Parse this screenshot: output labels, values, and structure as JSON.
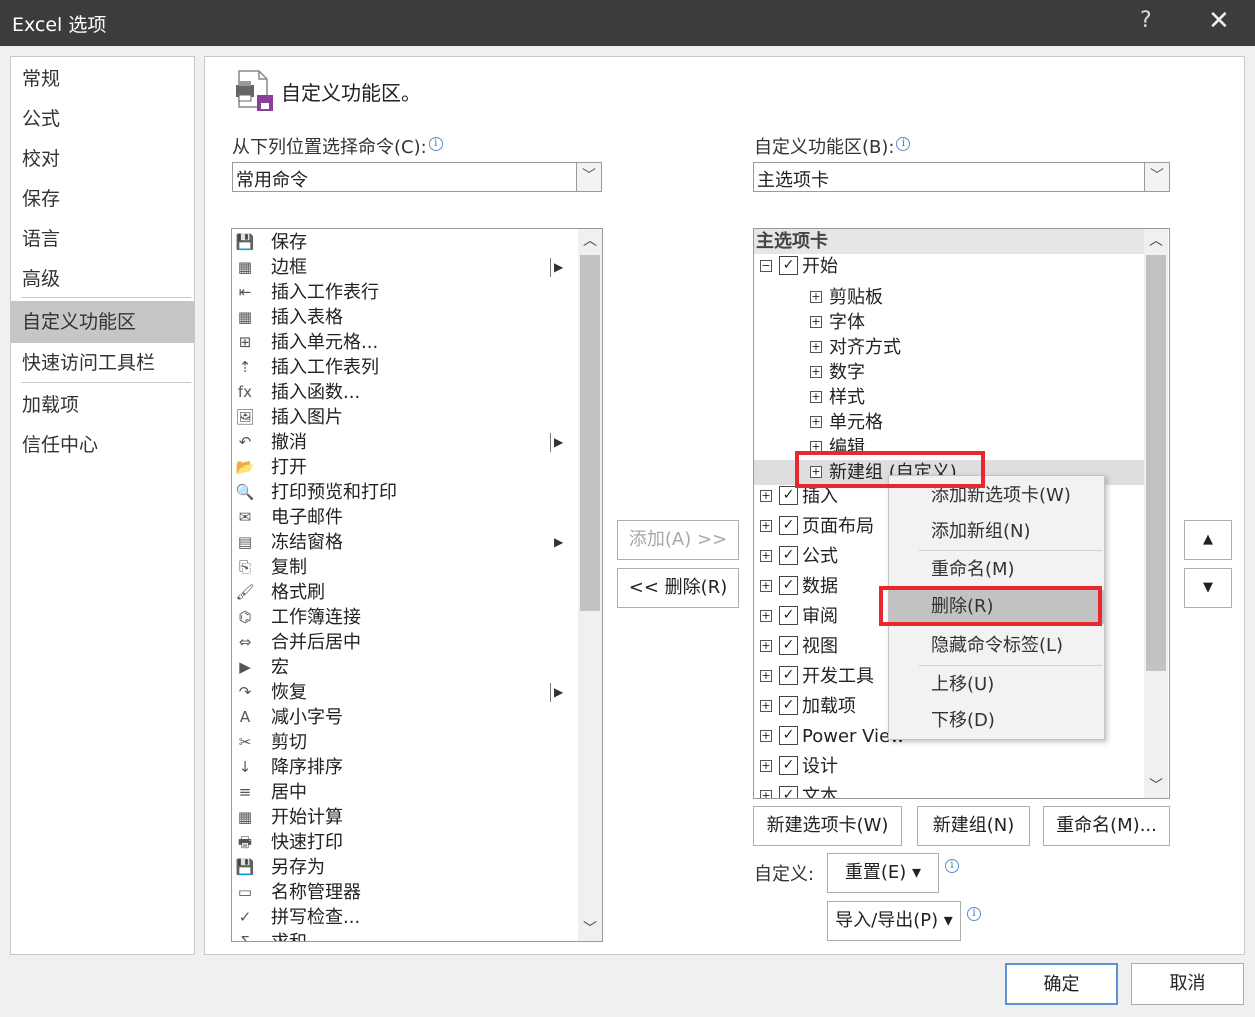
{
  "window": {
    "title": "Excel 选项",
    "help": "?",
    "close": "✕"
  },
  "sidebar": {
    "items": [
      {
        "label": "常规"
      },
      {
        "label": "公式"
      },
      {
        "label": "校对"
      },
      {
        "label": "保存"
      },
      {
        "label": "语言"
      },
      {
        "label": "高级"
      },
      {
        "label": "自定义功能区",
        "selected": true
      },
      {
        "label": "快速访问工具栏"
      },
      {
        "label": "加载项"
      },
      {
        "label": "信任中心"
      }
    ]
  },
  "main": {
    "heading": "自定义功能区。",
    "left_label": "从下列位置选择命令(C):",
    "left_combo": "常用命令",
    "right_label": "自定义功能区(B):",
    "right_combo": "主选项卡",
    "commands": [
      {
        "label": "保存",
        "icon": "save-icon",
        "glyph": "💾"
      },
      {
        "label": "边框",
        "icon": "border-icon",
        "glyph": "▦",
        "submenu": "bar"
      },
      {
        "label": "插入工作表行",
        "icon": "insert-row-icon",
        "glyph": "⇤"
      },
      {
        "label": "插入表格",
        "icon": "table-icon",
        "glyph": "▦"
      },
      {
        "label": "插入单元格...",
        "icon": "insert-cell-icon",
        "glyph": "⊞"
      },
      {
        "label": "插入工作表列",
        "icon": "insert-column-icon",
        "glyph": "⇡"
      },
      {
        "label": "插入函数...",
        "icon": "function-icon",
        "glyph": "fx"
      },
      {
        "label": "插入图片",
        "icon": "picture-icon",
        "glyph": "🖼"
      },
      {
        "label": "撤消",
        "icon": "undo-icon",
        "glyph": "↶",
        "submenu": "bar"
      },
      {
        "label": "打开",
        "icon": "open-folder-icon",
        "glyph": "📂"
      },
      {
        "label": "打印预览和打印",
        "icon": "print-preview-icon",
        "glyph": "🔍"
      },
      {
        "label": "电子邮件",
        "icon": "email-icon",
        "glyph": "✉"
      },
      {
        "label": "冻结窗格",
        "icon": "freeze-panes-icon",
        "glyph": "▤",
        "submenu": "arrow"
      },
      {
        "label": "复制",
        "icon": "copy-icon",
        "glyph": "⎘"
      },
      {
        "label": "格式刷",
        "icon": "format-painter-icon",
        "glyph": "🖌"
      },
      {
        "label": "工作簿连接",
        "icon": "workbook-connection-icon",
        "glyph": "⌬"
      },
      {
        "label": "合并后居中",
        "icon": "merge-center-icon",
        "glyph": "⇔"
      },
      {
        "label": "宏",
        "icon": "macro-icon",
        "glyph": "▶"
      },
      {
        "label": "恢复",
        "icon": "redo-icon",
        "glyph": "↷",
        "submenu": "bar"
      },
      {
        "label": "减小字号",
        "icon": "decrease-font-icon",
        "glyph": "A"
      },
      {
        "label": "剪切",
        "icon": "cut-icon",
        "glyph": "✂"
      },
      {
        "label": "降序排序",
        "icon": "sort-descending-icon",
        "glyph": "↓"
      },
      {
        "label": "居中",
        "icon": "align-center-icon",
        "glyph": "≡"
      },
      {
        "label": "开始计算",
        "icon": "calculator-icon",
        "glyph": "▦"
      },
      {
        "label": "快速打印",
        "icon": "quick-print-icon",
        "glyph": "🖶"
      },
      {
        "label": "另存为",
        "icon": "save-as-icon",
        "glyph": "💾"
      },
      {
        "label": "名称管理器",
        "icon": "name-manager-icon",
        "glyph": "▭"
      },
      {
        "label": "拼写检查...",
        "icon": "spell-check-icon",
        "glyph": "✓"
      },
      {
        "label": "求和",
        "icon": "sum-icon",
        "glyph": "Σ"
      }
    ],
    "add_button": "添加(A) >>",
    "remove_button": "<< 删除(R)",
    "tree": {
      "root": "主选项卡",
      "start_tab": "开始",
      "start_groups": [
        "剪贴板",
        "字体",
        "对齐方式",
        "数字",
        "样式",
        "单元格",
        "编辑",
        "新建组 (自定义)"
      ],
      "tabs": [
        "插入",
        "页面布局",
        "公式",
        "数据",
        "审阅",
        "视图",
        "开发工具",
        "加载项",
        "Power View",
        "设计",
        "文本"
      ]
    },
    "new_tab_button": "新建选项卡(W)",
    "new_group_button": "新建组(N)",
    "rename_button": "重命名(M)...",
    "customize_label": "自定义:",
    "reset_button": "重置(E) ▾",
    "import_export_button": "导入/导出(P) ▾",
    "move_up": "▲",
    "move_down": "▼"
  },
  "context_menu": {
    "items": [
      {
        "label": "添加新选项卡(W)"
      },
      {
        "label": "添加新组(N)"
      },
      {
        "label": "重命名(M)"
      },
      {
        "label": "删除(R)",
        "highlighted": true
      },
      {
        "label": "隐藏命令标签(L)"
      },
      {
        "label": "上移(U)"
      },
      {
        "label": "下移(D)"
      }
    ]
  },
  "footer": {
    "ok": "确定",
    "cancel": "取消"
  },
  "colors": {
    "highlight_box": "#e8272f",
    "titlebar": "#3c3c3c",
    "selected": "#c6c6c6"
  }
}
